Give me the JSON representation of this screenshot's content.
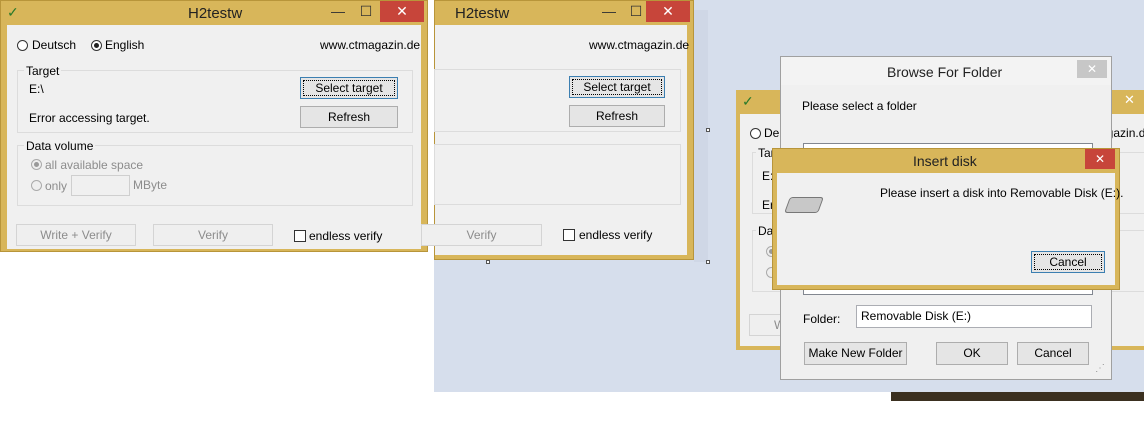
{
  "win1": {
    "title": "H2testw",
    "min": "—",
    "max": "☐",
    "close": "✕",
    "lang_de": "Deutsch",
    "lang_en": "English",
    "url": "www.ctmagazin.de",
    "target_label": "Target",
    "target_path": "E:\\",
    "select_target": "Select target",
    "error": "Error accessing target.",
    "refresh": "Refresh",
    "volume_label": "Data volume",
    "all_space": "all available space",
    "only": "only",
    "mbyte": "MByte",
    "write_verify": "Write + Verify",
    "verify": "Verify",
    "endless": "endless verify"
  },
  "win2": {
    "title": "H2testw",
    "min": "—",
    "max": "☐",
    "close": "✕",
    "url": "www.ctmagazin.de",
    "select_target": "Select target",
    "refresh": "Refresh",
    "verify": "Verify",
    "endless": "endless verify"
  },
  "win3": {
    "close": "✕",
    "lang_de": "Deu",
    "url": "agazin.de",
    "target_cut": "Tar",
    "target_path": "E:",
    "error_cut": "Err",
    "vol_cut": "Dat",
    "btn_cut": "W"
  },
  "browse": {
    "title": "Browse For Folder",
    "close": "✕",
    "prompt": "Please select a folder",
    "folder_label": "Folder:",
    "folder_value": "Removable Disk (E:)",
    "make_new": "Make New Folder",
    "ok": "OK",
    "cancel": "Cancel"
  },
  "insert": {
    "title": "Insert disk",
    "close": "✕",
    "message": "Please insert a disk into Removable Disk (E:).",
    "cancel": "Cancel"
  },
  "colors": {
    "title_bar": "#d8b65a",
    "close": "#c7453a",
    "desktop": "#d6deec"
  }
}
